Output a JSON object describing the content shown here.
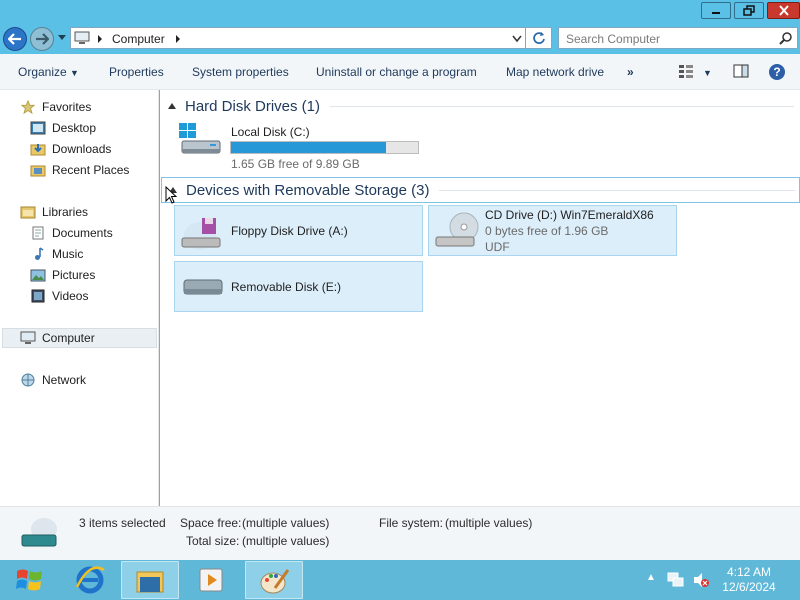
{
  "window": {
    "address": "Computer",
    "search_placeholder": "Search Computer"
  },
  "toolbar": {
    "organize": "Organize",
    "properties": "Properties",
    "system_properties": "System properties",
    "uninstall": "Uninstall or change a program",
    "map_drive": "Map network drive",
    "more": "»"
  },
  "nav": {
    "favorites": "Favorites",
    "desktop": "Desktop",
    "downloads": "Downloads",
    "recent": "Recent Places",
    "libraries": "Libraries",
    "documents": "Documents",
    "music": "Music",
    "pictures": "Pictures",
    "videos": "Videos",
    "computer": "Computer",
    "network": "Network"
  },
  "groups": {
    "hdd_title": "Hard Disk Drives (1)",
    "removable_title": "Devices with Removable Storage (3)"
  },
  "drives": {
    "c_name": "Local Disk (C:)",
    "c_free": "1.65 GB free of 9.89 GB",
    "c_used_fraction": 0.83,
    "floppy": "Floppy Disk Drive (A:)",
    "cd_name": "CD Drive (D:) Win7EmeraldX86",
    "cd_free": "0 bytes free of 1.96 GB",
    "cd_fs": "UDF",
    "removable": "Removable Disk (E:)"
  },
  "details": {
    "selected": "3 items selected",
    "space_free_label": "Space free:",
    "space_free_value": "(multiple values)",
    "total_size_label": "Total size:",
    "total_size_value": "(multiple values)",
    "fs_label": "File system:",
    "fs_value": "(multiple values)"
  },
  "taskbar": {
    "time": "4:12 AM",
    "date": "12/6/2024"
  },
  "colors": {
    "accent": "#5bc0e6",
    "progress": "#2698d8",
    "tile_selected": "#dceefa"
  }
}
